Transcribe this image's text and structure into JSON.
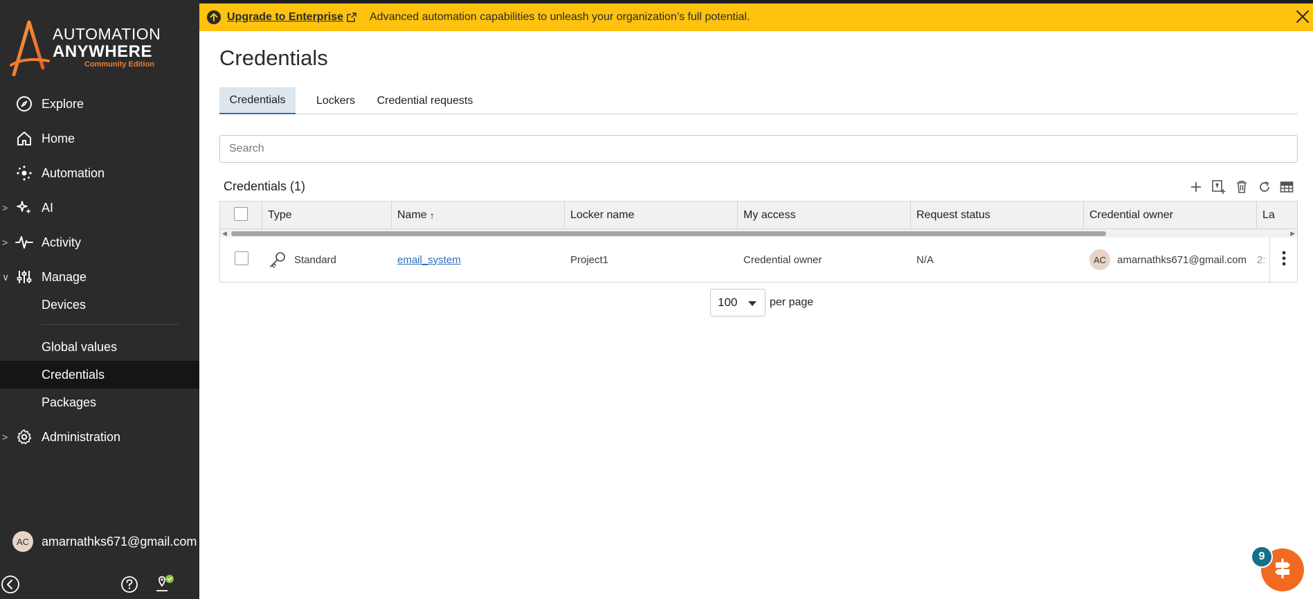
{
  "brand": {
    "line1": "AUTOMATION",
    "line2": "ANYWHERE",
    "edition": "Community Edition",
    "accent_color": "#f07d2e"
  },
  "sidebar": {
    "nav": [
      {
        "label": "Explore",
        "icon": "compass-icon"
      },
      {
        "label": "Home",
        "icon": "home-icon"
      },
      {
        "label": "Automation",
        "icon": "automation-icon"
      },
      {
        "label": "AI",
        "icon": "ai-sparkle-icon"
      },
      {
        "label": "Activity",
        "icon": "activity-pulse-icon"
      },
      {
        "label": "Manage",
        "icon": "sliders-icon"
      }
    ],
    "manage_sub": [
      {
        "label": "Devices"
      },
      {
        "label": "Global values"
      },
      {
        "label": "Credentials"
      },
      {
        "label": "Packages"
      }
    ],
    "admin": {
      "label": "Administration",
      "icon": "gear-icon"
    },
    "user": {
      "initials": "AC",
      "email": "amarnathks671@gmail.com"
    }
  },
  "banner": {
    "upgrade_label": "Upgrade to Enterprise",
    "message": "Advanced automation capabilities to unleash your organization’s full potential.",
    "color": "#ffc20e"
  },
  "page": {
    "title": "Credentials",
    "tabs": [
      {
        "label": "Credentials"
      },
      {
        "label": "Lockers"
      },
      {
        "label": "Credential requests"
      }
    ],
    "search_placeholder": "Search",
    "list_title": "Credentials (1)"
  },
  "table": {
    "headers": [
      "Type",
      "Name",
      "Locker name",
      "My access",
      "Request status",
      "Credential owner",
      "La"
    ],
    "sort_indicator": "↑",
    "rows": [
      {
        "type": "Standard",
        "name": "email_system",
        "locker": "Project1",
        "access": "Credential owner",
        "request_status": "N/A",
        "owner_initials": "AC",
        "owner": "amarnathks671@gmail.com",
        "last": "2:"
      }
    ]
  },
  "pager": {
    "size": "100",
    "label": "per page"
  },
  "fab": {
    "badge": "9",
    "color": "#f26a21"
  }
}
